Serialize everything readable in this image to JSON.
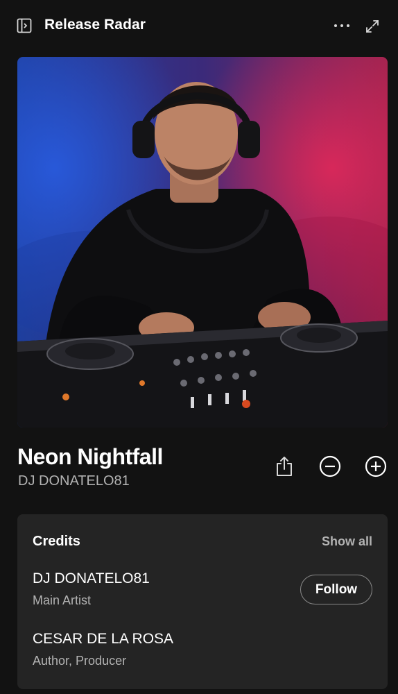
{
  "header": {
    "title": "Release Radar",
    "icons": [
      "sidebar-toggle-icon",
      "more-options-icon",
      "expand-icon"
    ]
  },
  "cover": {
    "description_icon": "cover-art",
    "colors": {
      "left_glow": "#2f5ad8",
      "right_glow": "#d8285a"
    }
  },
  "track": {
    "title": "Neon Nightfall",
    "artist": "DJ DONATELO81",
    "actions": [
      "share-icon",
      "remove-icon",
      "add-icon"
    ]
  },
  "credits": {
    "heading": "Credits",
    "show_all_label": "Show all",
    "follow_label": "Follow",
    "items": [
      {
        "name": "DJ DONATELO81",
        "role": "Main Artist"
      },
      {
        "name": "CESAR DE LA ROSA",
        "role": "Author, Producer"
      }
    ]
  },
  "colors": {
    "background": "#121212",
    "card": "#242424",
    "secondary_text": "#b3b3b3"
  }
}
